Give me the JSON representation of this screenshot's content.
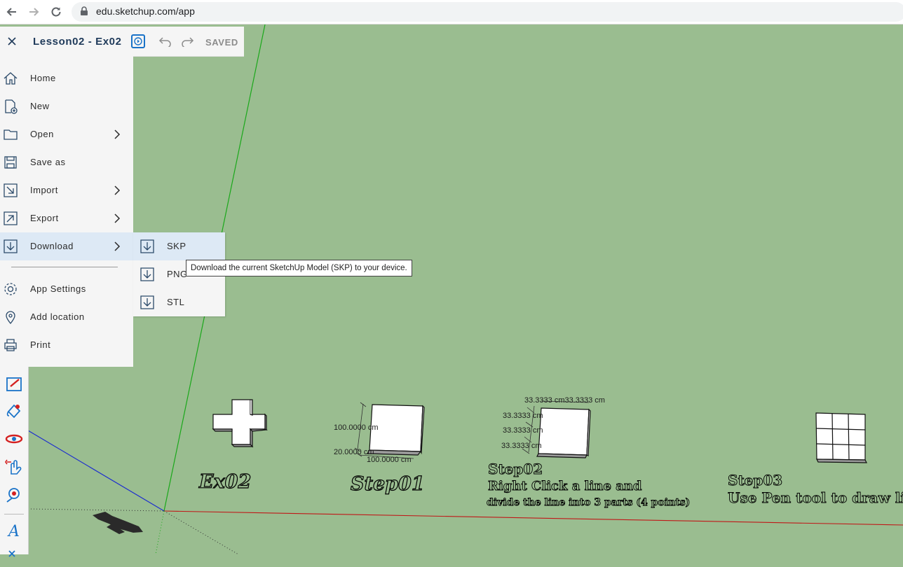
{
  "browser": {
    "url": "edu.sketchup.com/app"
  },
  "app_bar": {
    "close_label": "×",
    "title": "Lesson02 - Ex02",
    "status": "SAVED"
  },
  "menu": {
    "items": [
      {
        "label": "Home",
        "icon": "home-icon"
      },
      {
        "label": "New",
        "icon": "new-file-icon"
      },
      {
        "label": "Open",
        "icon": "folder-icon",
        "submenu": true
      },
      {
        "label": "Save as",
        "icon": "save-icon"
      },
      {
        "label": "Import",
        "icon": "import-icon",
        "submenu": true
      },
      {
        "label": "Export",
        "icon": "export-icon",
        "submenu": true
      },
      {
        "label": "Download",
        "icon": "download-icon",
        "submenu": true,
        "active": true
      },
      {
        "label": "App Settings",
        "icon": "gear-icon"
      },
      {
        "label": "Add location",
        "icon": "location-pin-icon"
      },
      {
        "label": "Print",
        "icon": "printer-icon"
      }
    ]
  },
  "download_submenu": {
    "items": [
      {
        "label": "SKP",
        "active": true
      },
      {
        "label": "PNG"
      },
      {
        "label": "STL"
      }
    ]
  },
  "tooltip": {
    "text": "Download the current SketchUp Model (SKP) to your device."
  },
  "canvas": {
    "ex02_label": "Ex02",
    "step01": {
      "label": "Step01",
      "dim_width": "100.0000 cm",
      "dim_height": "20.0000 cm",
      "dim_bottom": "100.0000 cm"
    },
    "step02": {
      "title": "Step02",
      "line1": "Right Click a line and",
      "line2": "divide the line into 3 parts (4 points)",
      "dim_top": "33.3333 cm33.3333 cm",
      "dim_1": "33.3333 cm",
      "dim_2": "33.3333 cm",
      "dim_3": "33.3333 cm"
    },
    "step03": {
      "title": "Step03",
      "line1": "Use Pen tool to draw lines"
    }
  },
  "colors": {
    "canvas_bg": "#9abd90",
    "accent": "#1a73c8",
    "menu_bg": "#f5f5f5",
    "active_bg": "#dde9f5"
  }
}
